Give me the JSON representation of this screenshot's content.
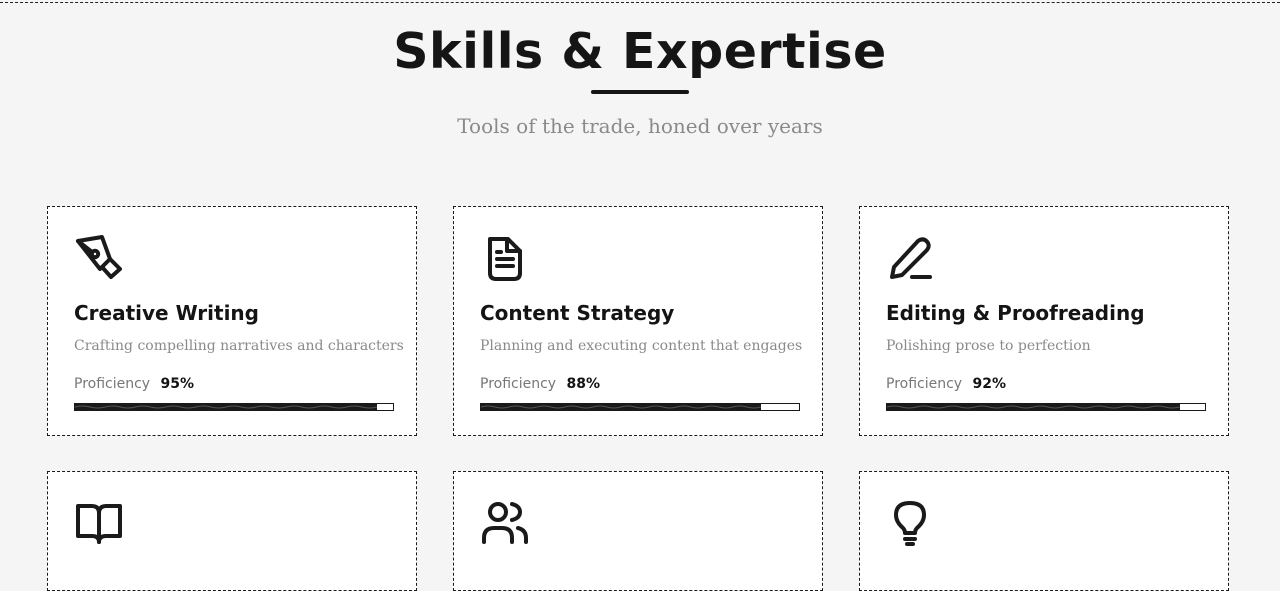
{
  "header": {
    "title": "Skills & Expertise",
    "subtitle": "Tools of the trade, honed over years"
  },
  "proficiency_label": "Proficiency",
  "skills": [
    {
      "icon": "pen-nib-icon",
      "title": "Creative Writing",
      "description": "Crafting compelling narratives and characters",
      "proficiency": 95,
      "proficiency_text": "95%"
    },
    {
      "icon": "document-icon",
      "title": "Content Strategy",
      "description": "Planning and executing content that engages",
      "proficiency": 88,
      "proficiency_text": "88%"
    },
    {
      "icon": "pencil-icon",
      "title": "Editing & Proofreading",
      "description": "Polishing prose to perfection",
      "proficiency": 92,
      "proficiency_text": "92%"
    },
    {
      "icon": "open-book-icon"
    },
    {
      "icon": "users-icon"
    },
    {
      "icon": "lightbulb-icon"
    }
  ],
  "colors": {
    "background": "#f5f5f5",
    "card": "#ffffff",
    "ink": "#151515",
    "muted": "#8a8a8a"
  }
}
